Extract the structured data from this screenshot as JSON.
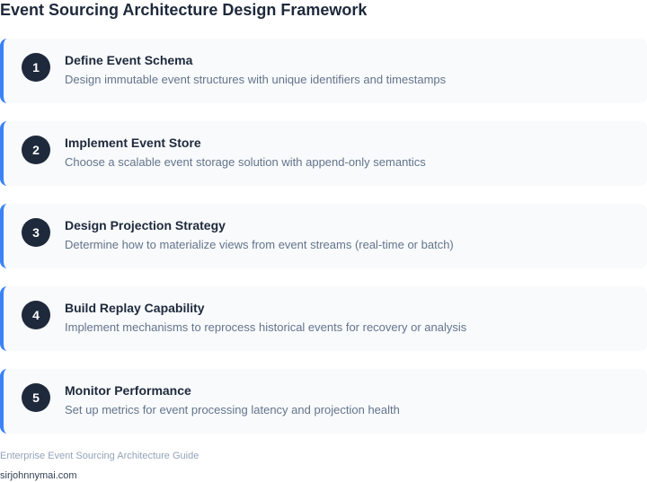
{
  "title": "Event Sourcing Architecture Design Framework",
  "steps": [
    {
      "number": "1",
      "title": "Define Event Schema",
      "description": "Design immutable event structures with unique identifiers and timestamps"
    },
    {
      "number": "2",
      "title": "Implement Event Store",
      "description": "Choose a scalable event storage solution with append-only semantics"
    },
    {
      "number": "3",
      "title": "Design Projection Strategy",
      "description": "Determine how to materialize views from event streams (real-time or batch)"
    },
    {
      "number": "4",
      "title": "Build Replay Capability",
      "description": "Implement mechanisms to reprocess historical events for recovery or analysis"
    },
    {
      "number": "5",
      "title": "Monitor Performance",
      "description": "Set up metrics for event processing latency and projection health"
    }
  ],
  "footer": {
    "note": "Enterprise Event Sourcing Architecture Guide",
    "site": "sirjohnnymai.com"
  },
  "colors": {
    "accent": "#3b82f6",
    "badge": "#1e293b",
    "card_background": "#f8fafc",
    "title_text": "#1e293b",
    "description_text": "#64748b"
  }
}
